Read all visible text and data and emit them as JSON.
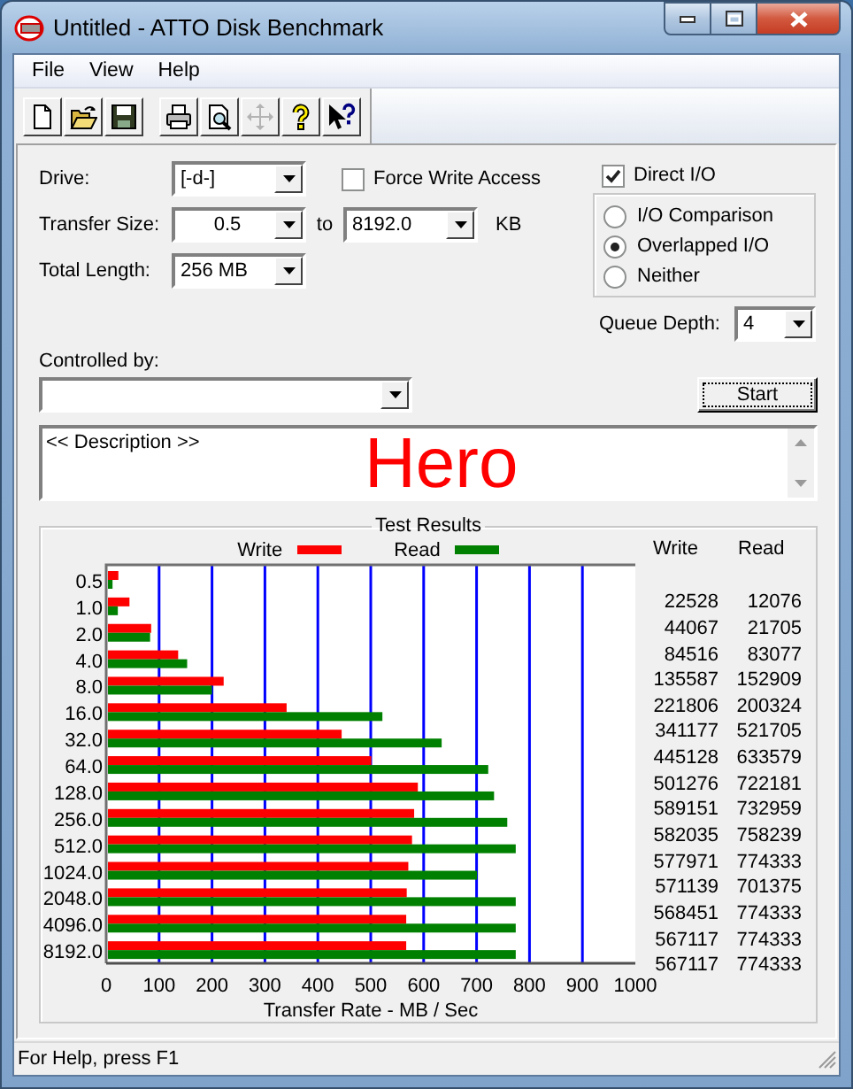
{
  "window": {
    "title": "Untitled - ATTO Disk Benchmark"
  },
  "menu": [
    {
      "label": "File"
    },
    {
      "label": "View"
    },
    {
      "label": "Help"
    }
  ],
  "toolbar": [
    {
      "kind": "new",
      "disabled": false
    },
    {
      "kind": "open",
      "disabled": false
    },
    {
      "kind": "save",
      "disabled": false
    },
    {
      "kind": "print",
      "disabled": false
    },
    {
      "kind": "preview",
      "disabled": false
    },
    {
      "kind": "move",
      "disabled": true
    },
    {
      "kind": "help",
      "disabled": false
    },
    {
      "kind": "context-help",
      "disabled": false
    }
  ],
  "settings": {
    "drive": {
      "label": "Drive:",
      "value": "[-d-]"
    },
    "force_write_access": {
      "label": "Force Write Access",
      "checked": false
    },
    "transfer_size": {
      "label": "Transfer Size:",
      "from": "0.5",
      "to_label": "to",
      "to": "8192.0",
      "unit": "KB"
    },
    "total_length": {
      "label": "Total Length:",
      "value": "256 MB"
    },
    "direct_io": {
      "label": "Direct I/O",
      "checked": true
    },
    "io_mode": [
      {
        "label": "I/O Comparison",
        "selected": false
      },
      {
        "label": "Overlapped I/O",
        "selected": true
      },
      {
        "label": "Neither",
        "selected": false
      }
    ],
    "queue_depth": {
      "label": "Queue Depth:",
      "value": "4"
    },
    "controlled_by": {
      "label": "Controlled by:"
    }
  },
  "start_button": {
    "label": "Start"
  },
  "description": {
    "text": "<< Description >>",
    "note": "Hero"
  },
  "results": {
    "title": "Test Results",
    "chart_data": {
      "type": "bar",
      "orientation": "horizontal",
      "xlabel": "Transfer Rate - MB / Sec",
      "categories": [
        "0.5",
        "1.0",
        "2.0",
        "4.0",
        "8.0",
        "16.0",
        "32.0",
        "64.0",
        "128.0",
        "256.0",
        "512.0",
        "1024.0",
        "2048.0",
        "4096.0",
        "8192.0"
      ],
      "series": [
        {
          "name": "Write",
          "color": "#ff0000",
          "values": [
            23,
            44,
            85,
            136,
            222,
            341,
            445,
            501,
            589,
            582,
            578,
            571,
            568,
            567,
            567
          ]
        },
        {
          "name": "Read",
          "color": "#008000",
          "values": [
            12,
            22,
            83,
            153,
            200,
            522,
            634,
            722,
            733,
            758,
            774,
            701,
            774,
            774,
            774
          ]
        }
      ],
      "grid": true,
      "xlim": [
        0,
        1000
      ],
      "xticks": [
        0,
        100,
        200,
        300,
        400,
        500,
        600,
        700,
        800,
        900,
        1000
      ]
    },
    "table": {
      "columns": [
        "Write",
        "Read"
      ],
      "rows": [
        [
          "22528",
          "12076"
        ],
        [
          "44067",
          "21705"
        ],
        [
          "84516",
          "83077"
        ],
        [
          "135587",
          "152909"
        ],
        [
          "221806",
          "200324"
        ],
        [
          "341177",
          "521705"
        ],
        [
          "445128",
          "633579"
        ],
        [
          "501276",
          "722181"
        ],
        [
          "589151",
          "732959"
        ],
        [
          "582035",
          "758239"
        ],
        [
          "577971",
          "774333"
        ],
        [
          "571139",
          "701375"
        ],
        [
          "568451",
          "774333"
        ],
        [
          "567117",
          "774333"
        ],
        [
          "567117",
          "774333"
        ]
      ]
    }
  },
  "status_bar": {
    "text": "For Help, press F1"
  }
}
